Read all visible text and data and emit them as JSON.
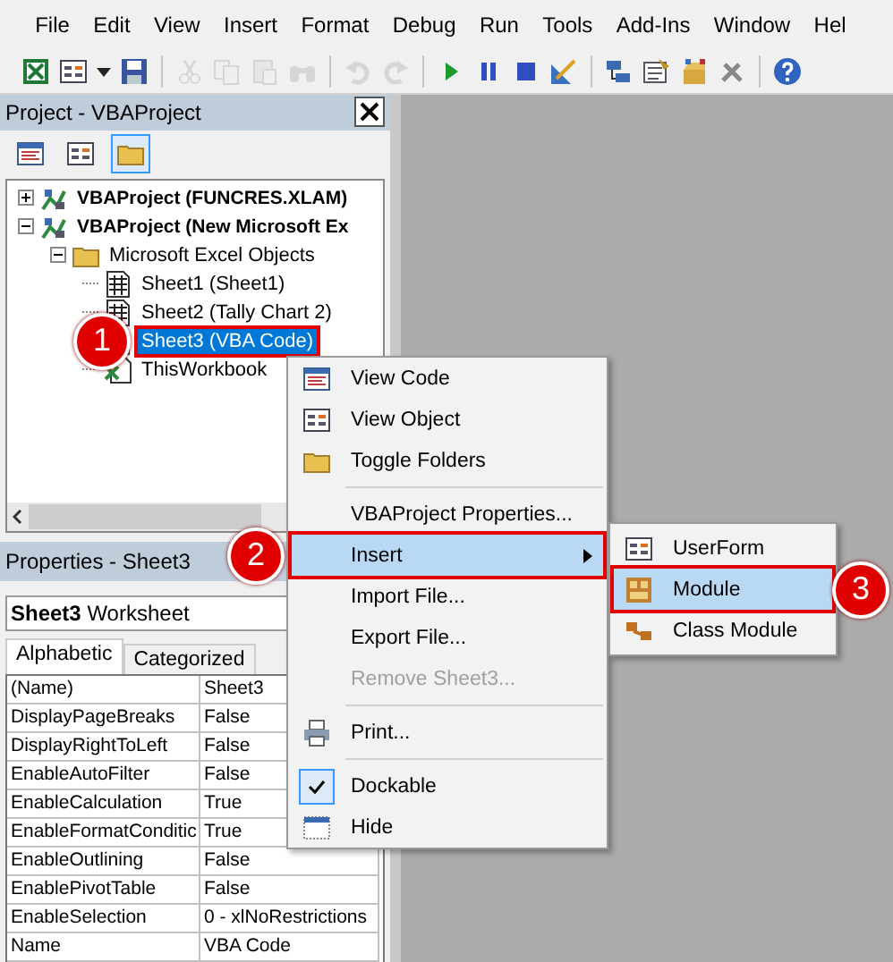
{
  "menu_bar": [
    "File",
    "Edit",
    "View",
    "Insert",
    "Format",
    "Debug",
    "Run",
    "Tools",
    "Add-Ins",
    "Window",
    "Hel"
  ],
  "toolbar": [
    {
      "kind": "excel",
      "disabled": false
    },
    {
      "kind": "form",
      "disabled": false
    },
    {
      "kind": "caret",
      "disabled": false
    },
    {
      "kind": "save",
      "disabled": false
    },
    {
      "kind": "sep"
    },
    {
      "kind": "cut",
      "disabled": true
    },
    {
      "kind": "copy",
      "disabled": true
    },
    {
      "kind": "paste",
      "disabled": true
    },
    {
      "kind": "find",
      "disabled": true
    },
    {
      "kind": "sep"
    },
    {
      "kind": "undo",
      "disabled": true
    },
    {
      "kind": "redo",
      "disabled": true
    },
    {
      "kind": "sep"
    },
    {
      "kind": "run",
      "disabled": false
    },
    {
      "kind": "pause",
      "disabled": false
    },
    {
      "kind": "stop",
      "disabled": false
    },
    {
      "kind": "ruler",
      "disabled": false
    },
    {
      "kind": "sep"
    },
    {
      "kind": "explorer",
      "disabled": false
    },
    {
      "kind": "properties",
      "disabled": false
    },
    {
      "kind": "box",
      "disabled": false
    },
    {
      "kind": "tools",
      "disabled": false
    },
    {
      "kind": "sep"
    },
    {
      "kind": "help",
      "disabled": false
    }
  ],
  "project_panel": {
    "title": "Project - VBAProject",
    "tool_buttons": [
      {
        "kind": "code",
        "selected": false
      },
      {
        "kind": "form",
        "selected": false
      },
      {
        "kind": "folder",
        "selected": true
      }
    ],
    "tree": [
      {
        "label": "VBAProject (FUNCRES.XLAM)",
        "kind": "project",
        "expanded": false,
        "selected": false
      },
      {
        "label": "VBAProject (New Microsoft Ex",
        "kind": "project",
        "expanded": true,
        "selected": false,
        "children": [
          {
            "label": "Microsoft Excel Objects",
            "kind": "folder",
            "expanded": true,
            "selected": false,
            "children": [
              {
                "label": "Sheet1 (Sheet1)",
                "kind": "sheet",
                "selected": false
              },
              {
                "label": "Sheet2 (Tally Chart 2)",
                "kind": "sheet",
                "selected": false
              },
              {
                "label": "Sheet3 (VBA Code)",
                "kind": "sheet",
                "selected": true,
                "callout": "1"
              },
              {
                "label": "ThisWorkbook",
                "kind": "workbook",
                "selected": false
              }
            ]
          }
        ]
      }
    ]
  },
  "properties_panel": {
    "title": "Properties - Sheet3",
    "object": "**Sheet3** Worksheet",
    "tabs": [
      {
        "label": "Alphabetic",
        "selected": true
      },
      {
        "label": "Categorized",
        "selected": false
      }
    ],
    "rows": [
      [
        "(Name)",
        "Sheet3"
      ],
      [
        "DisplayPageBreaks",
        "False"
      ],
      [
        "DisplayRightToLeft",
        "False"
      ],
      [
        "EnableAutoFilter",
        "False"
      ],
      [
        "EnableCalculation",
        "True"
      ],
      [
        "EnableFormatConditic",
        "True"
      ],
      [
        "EnableOutlining",
        "False"
      ],
      [
        "EnablePivotTable",
        "False"
      ],
      [
        "EnableSelection",
        "0 - xlNoRestrictions"
      ],
      [
        "Name",
        "VBA Code"
      ]
    ]
  },
  "context_menu": [
    {
      "kind": "code",
      "label": "View Code",
      "selected": false
    },
    {
      "kind": "form",
      "label": "View Object",
      "selected": false
    },
    {
      "kind": "folder",
      "label": "Toggle Folders",
      "selected": false
    },
    {
      "kind": "separator"
    },
    {
      "kind": "plain",
      "label": "VBAProject Properties...",
      "selected": false
    },
    {
      "kind": "plain",
      "label": "Insert",
      "selected": true,
      "has_submenu": true,
      "callout": "2"
    },
    {
      "kind": "plain",
      "label": "Import File...",
      "selected": false
    },
    {
      "kind": "plain",
      "label": "Export File...",
      "selected": false
    },
    {
      "kind": "plain",
      "label": "Remove Sheet3...",
      "selected": false,
      "disabled": true
    },
    {
      "kind": "separator"
    },
    {
      "kind": "print",
      "label": "Print...",
      "selected": false
    },
    {
      "kind": "separator"
    },
    {
      "kind": "plain",
      "label": "Dockable",
      "selected": false,
      "checked": true
    },
    {
      "kind": "window",
      "label": "Hide",
      "selected": false
    }
  ],
  "submenu": [
    {
      "kind": "form",
      "label": "UserForm",
      "selected": false
    },
    {
      "kind": "module",
      "label": "Module",
      "selected": true,
      "callout": "3"
    },
    {
      "kind": "class",
      "label": "Class Module",
      "selected": false
    }
  ]
}
